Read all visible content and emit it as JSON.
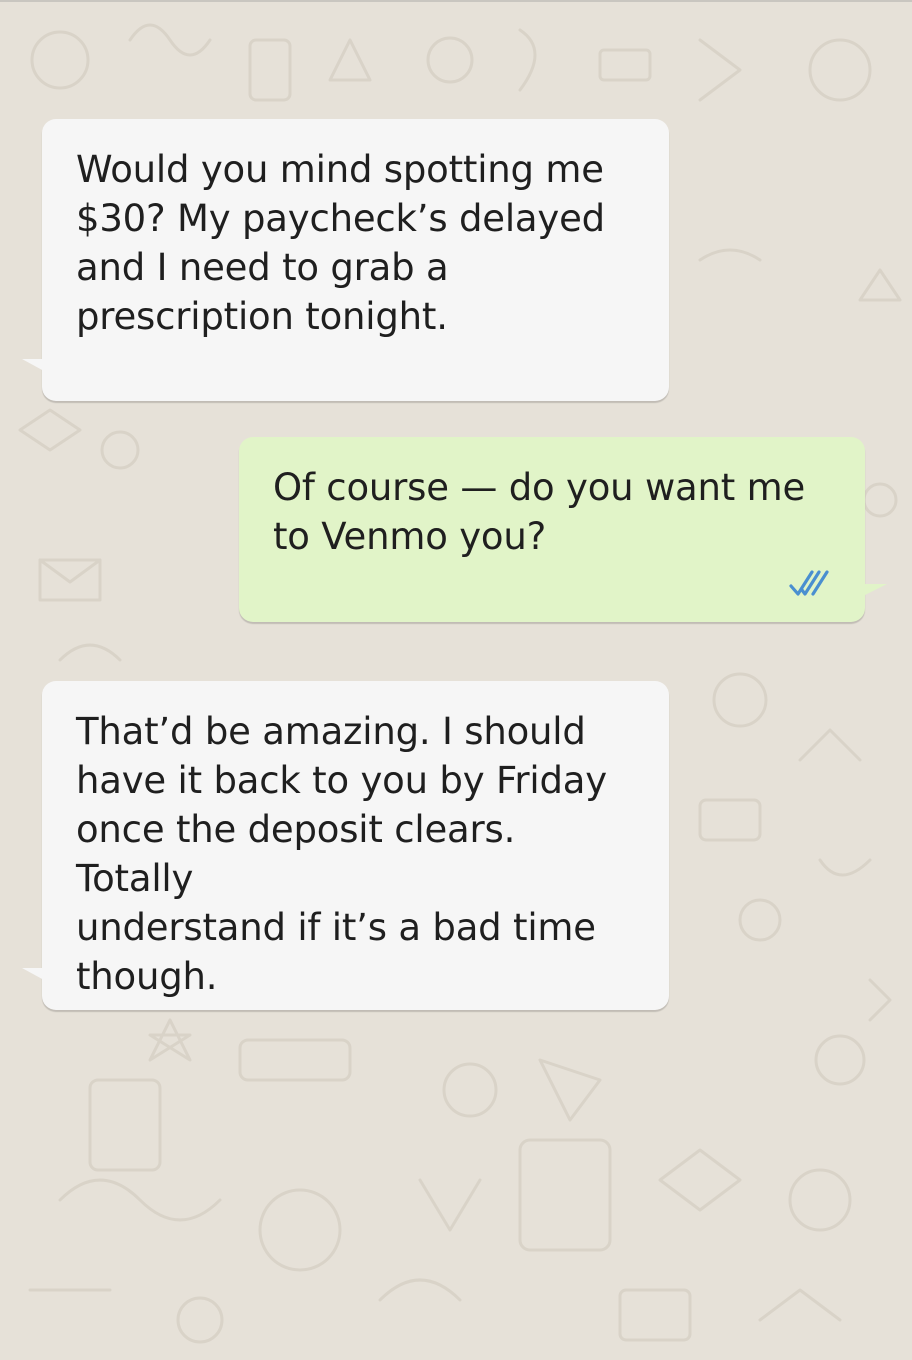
{
  "conversation": {
    "messages": [
      {
        "direction": "incoming",
        "text": "Would you mind spotting me\n$30? My paycheck’s delayed\nand I need to grab a\nprescription tonight."
      },
      {
        "direction": "outgoing",
        "text": "Of course — do you want me\nto Venmo you?",
        "status_icon": "double-check-read-icon"
      },
      {
        "direction": "incoming",
        "text": "That’d be amazing. I should\nhave it back to you by Friday\nonce the deposit clears. Totally\nunderstand if it’s a bad time\nthough."
      }
    ]
  },
  "colors": {
    "wallpaper": "#e6e1d8",
    "incoming_bubble": "#f6f6f6",
    "outgoing_bubble": "#e1f4c8",
    "read_ticks": "#4a8fd0",
    "text": "#1f1f1f"
  }
}
